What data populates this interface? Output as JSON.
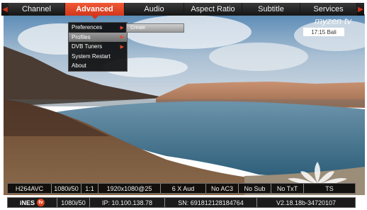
{
  "menubar": {
    "left_arrow": "◀",
    "right_arrow": "▶",
    "tabs": [
      {
        "label": "Channel",
        "active": false
      },
      {
        "label": "Advanced",
        "active": true
      },
      {
        "label": "Audio",
        "active": false
      },
      {
        "label": "Aspect Ratio",
        "active": false
      },
      {
        "label": "Subtitle",
        "active": false
      },
      {
        "label": "Services",
        "active": false
      }
    ]
  },
  "dropdown": {
    "items": [
      {
        "label": "Preferences",
        "has_submenu": true
      },
      {
        "label": "Profiles",
        "has_submenu": true,
        "highlighted": true
      },
      {
        "label": "DVB Tuners",
        "has_submenu": true
      },
      {
        "label": "System Restart",
        "has_submenu": false
      },
      {
        "label": "About",
        "has_submenu": false
      }
    ],
    "submenu_arrow": "▶",
    "submenu": {
      "label": "Create"
    }
  },
  "brand": {
    "name": "myzen tv"
  },
  "clock": {
    "text": "17:15 Bali"
  },
  "status_top": {
    "cells": [
      "H264AVC",
      "1080i/50",
      "1:1",
      "1920x1080@25",
      "6 X Aud",
      "No AC3",
      "No Sub",
      "No TxT",
      "TS"
    ]
  },
  "status_bottom": {
    "logo_text": "iNES",
    "logo_mark": "tv",
    "cells": [
      "1080i/50",
      "IP: 10.100.138.78",
      "SN: 691812128184764",
      "V2.18.18b-34720107"
    ]
  },
  "colors": {
    "accent": "#e2421f",
    "menubar": "#1a1a1a",
    "highlight": "#8a8a8a"
  }
}
